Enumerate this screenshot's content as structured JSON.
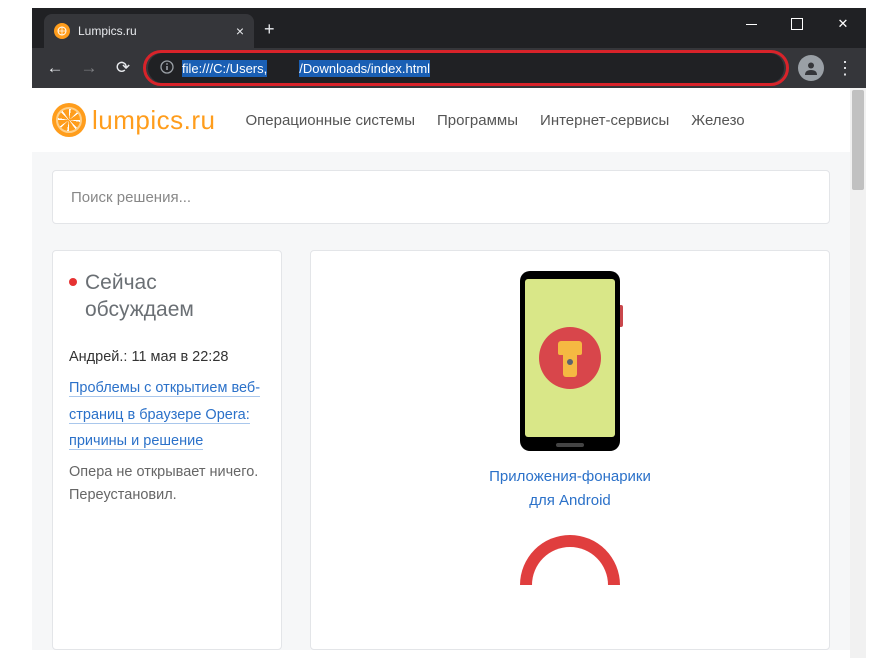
{
  "tab": {
    "title": "Lumpics.ru"
  },
  "address": {
    "prefix": "file:///C:/Users,",
    "suffix": "/Downloads/index.html"
  },
  "site": {
    "logo": "lumpics.ru",
    "nav": {
      "os": "Операционные системы",
      "programs": "Программы",
      "services": "Интернет-сервисы",
      "hardware": "Железо"
    },
    "search_placeholder": "Поиск решения..."
  },
  "sidebar": {
    "title": "Сейчас обсуждаем",
    "comment": {
      "meta": "Андрей.: 11 мая в 22:28",
      "link": "Проблемы с открытием веб-страниц в браузере Opera: причины и решение",
      "text": "Опера не открывает ничего. Переустановил."
    }
  },
  "article": {
    "line1": "Приложения-фонарики",
    "line2": "для Android"
  }
}
